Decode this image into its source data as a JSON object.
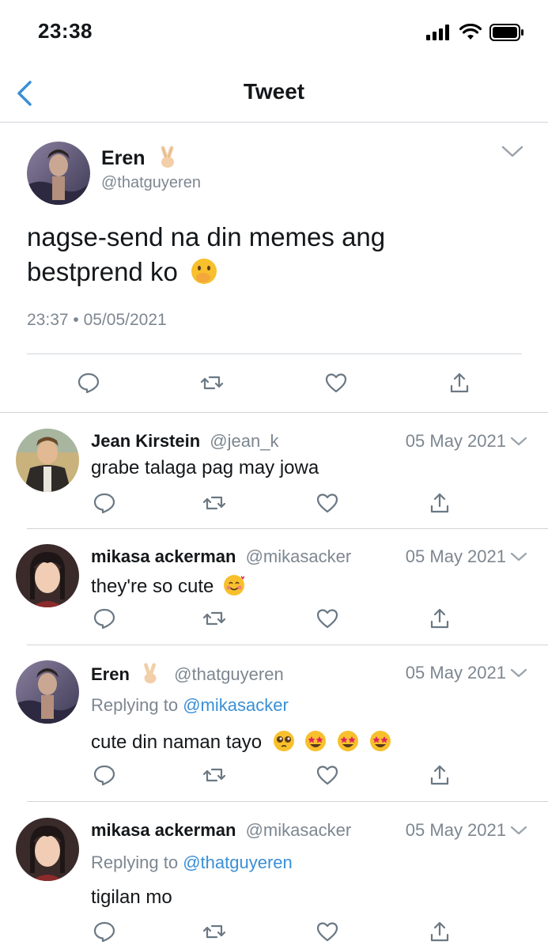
{
  "status_bar": {
    "time": "23:38"
  },
  "nav": {
    "title": "Tweet"
  },
  "main_tweet": {
    "name": "Eren",
    "handle": "@thatguyeren",
    "text_line1": "nagse-send na din memes ang",
    "text_line2": "bestprend ko",
    "timestamp": "23:37 • 05/05/2021"
  },
  "replies": [
    {
      "name": "Jean Kirstein",
      "handle": "@jean_k",
      "date": "05 May 2021",
      "replying_prefix": "",
      "replying_to": "",
      "text": "grabe talaga pag may jowa"
    },
    {
      "name": "mikasa ackerman",
      "handle": "@mikasacker",
      "date": "05 May 2021",
      "replying_prefix": "",
      "replying_to": "",
      "text": "they're so cute"
    },
    {
      "name": "Eren",
      "handle": "@thatguyeren",
      "date": "05 May 2021",
      "replying_prefix": "Replying to",
      "replying_to": "@mikasacker",
      "text": "cute din naman tayo"
    },
    {
      "name": "mikasa ackerman",
      "handle": "@mikasacker",
      "date": "05 May 2021",
      "replying_prefix": "Replying to",
      "replying_to": "@thatguyeren",
      "text": "tigilan mo"
    }
  ],
  "icons": {
    "action_color": "#6b7884",
    "accent": "#3a8fd6"
  }
}
